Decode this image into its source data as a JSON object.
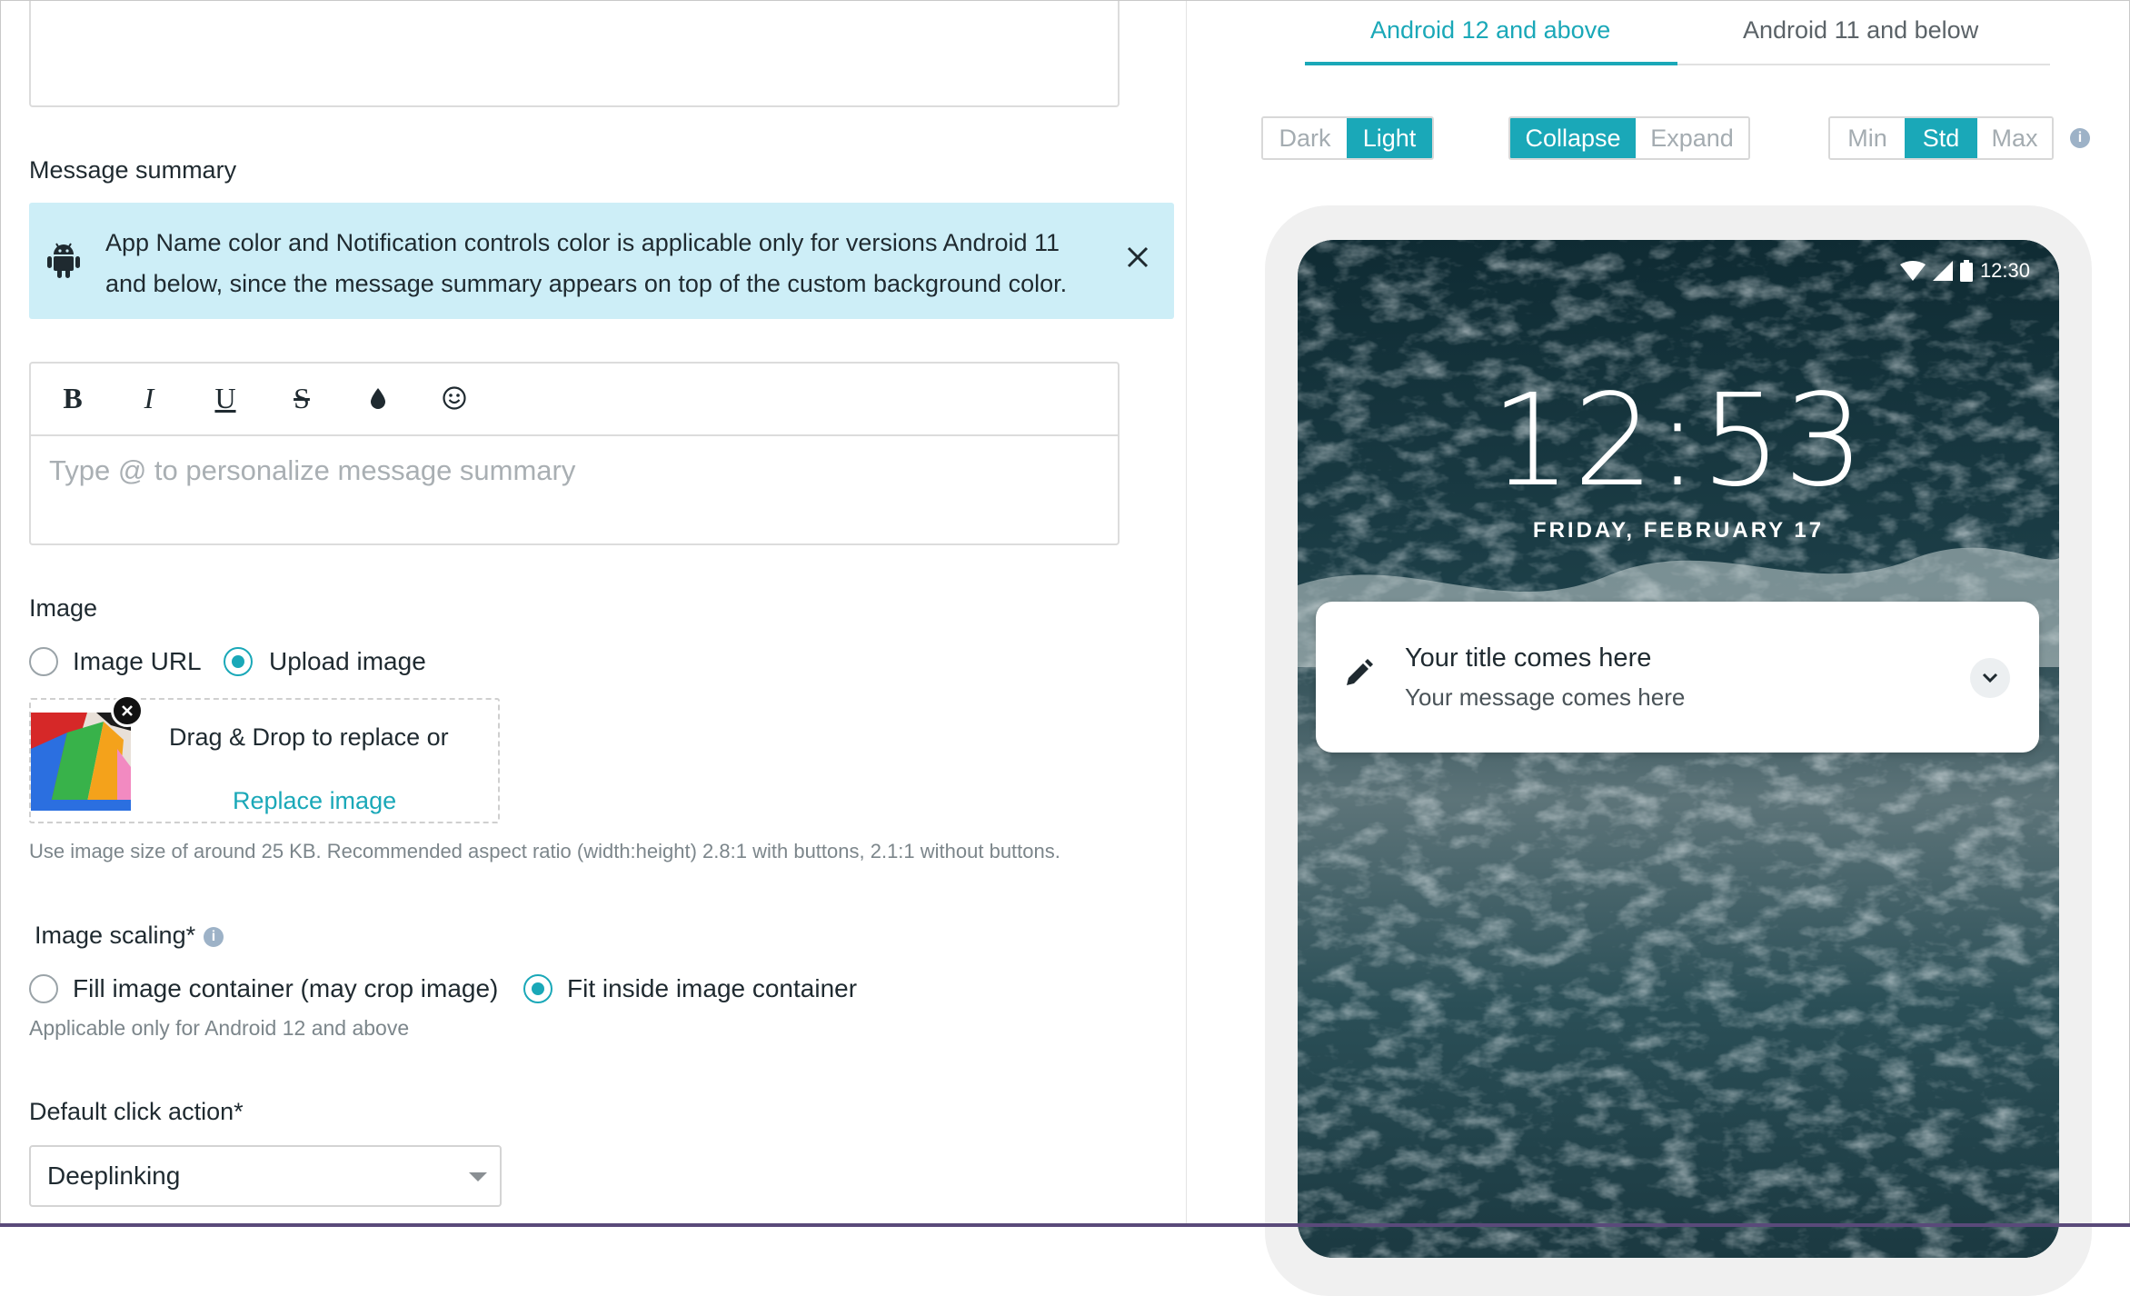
{
  "colors": {
    "accent": "#1aa8b8",
    "banner_bg": "#cdeef7",
    "placeholder": "#a9afb3",
    "hint": "#7c868b"
  },
  "form": {
    "message_summary": {
      "label": "Message summary",
      "banner": {
        "icon": "android-icon",
        "text": "App Name color and Notification controls color is applicable only for versions Android 11 and below, since the message summary appears on top of the custom background color.",
        "close_icon": "close-icon"
      },
      "toolbar": {
        "bold": "B",
        "italic": "I",
        "underline": "U",
        "strike": "S",
        "color_icon": "drop-icon",
        "emoji_icon": "emoji-icon"
      },
      "placeholder": "Type @ to personalize message summary"
    },
    "image": {
      "label": "Image",
      "options": [
        "Image URL",
        "Upload image"
      ],
      "selected": "Upload image",
      "drop_text": "Drag & Drop to replace or",
      "replace_link": "Replace image",
      "hint": "Use image size of around 25 KB. Recommended aspect ratio (width:height) 2.8:1 with buttons, 2.1:1 without buttons."
    },
    "image_scaling": {
      "label": "Image scaling*",
      "info_icon": "info-icon",
      "options": [
        "Fill image container (may crop image)",
        "Fit inside image container"
      ],
      "selected": "Fit inside image container",
      "hint": "Applicable only for Android 12 and above"
    },
    "default_click_action": {
      "label": "Default click action*",
      "value": "Deeplinking"
    }
  },
  "preview": {
    "tabs": [
      "Android 12 and above",
      "Android 11 and below"
    ],
    "active_tab": "Android 12 and above",
    "theme": {
      "options": [
        "Dark",
        "Light"
      ],
      "active": "Light"
    },
    "view": {
      "options": [
        "Collapse",
        "Expand"
      ],
      "active": "Collapse"
    },
    "size": {
      "options": [
        "Min",
        "Std",
        "Max"
      ],
      "active": "Std"
    },
    "phone": {
      "status_time": "12:30",
      "clock": "12:53",
      "date": "FRIDAY, FEBRUARY 17",
      "notification": {
        "title": "Your title comes here",
        "message": "Your message comes here"
      }
    }
  }
}
